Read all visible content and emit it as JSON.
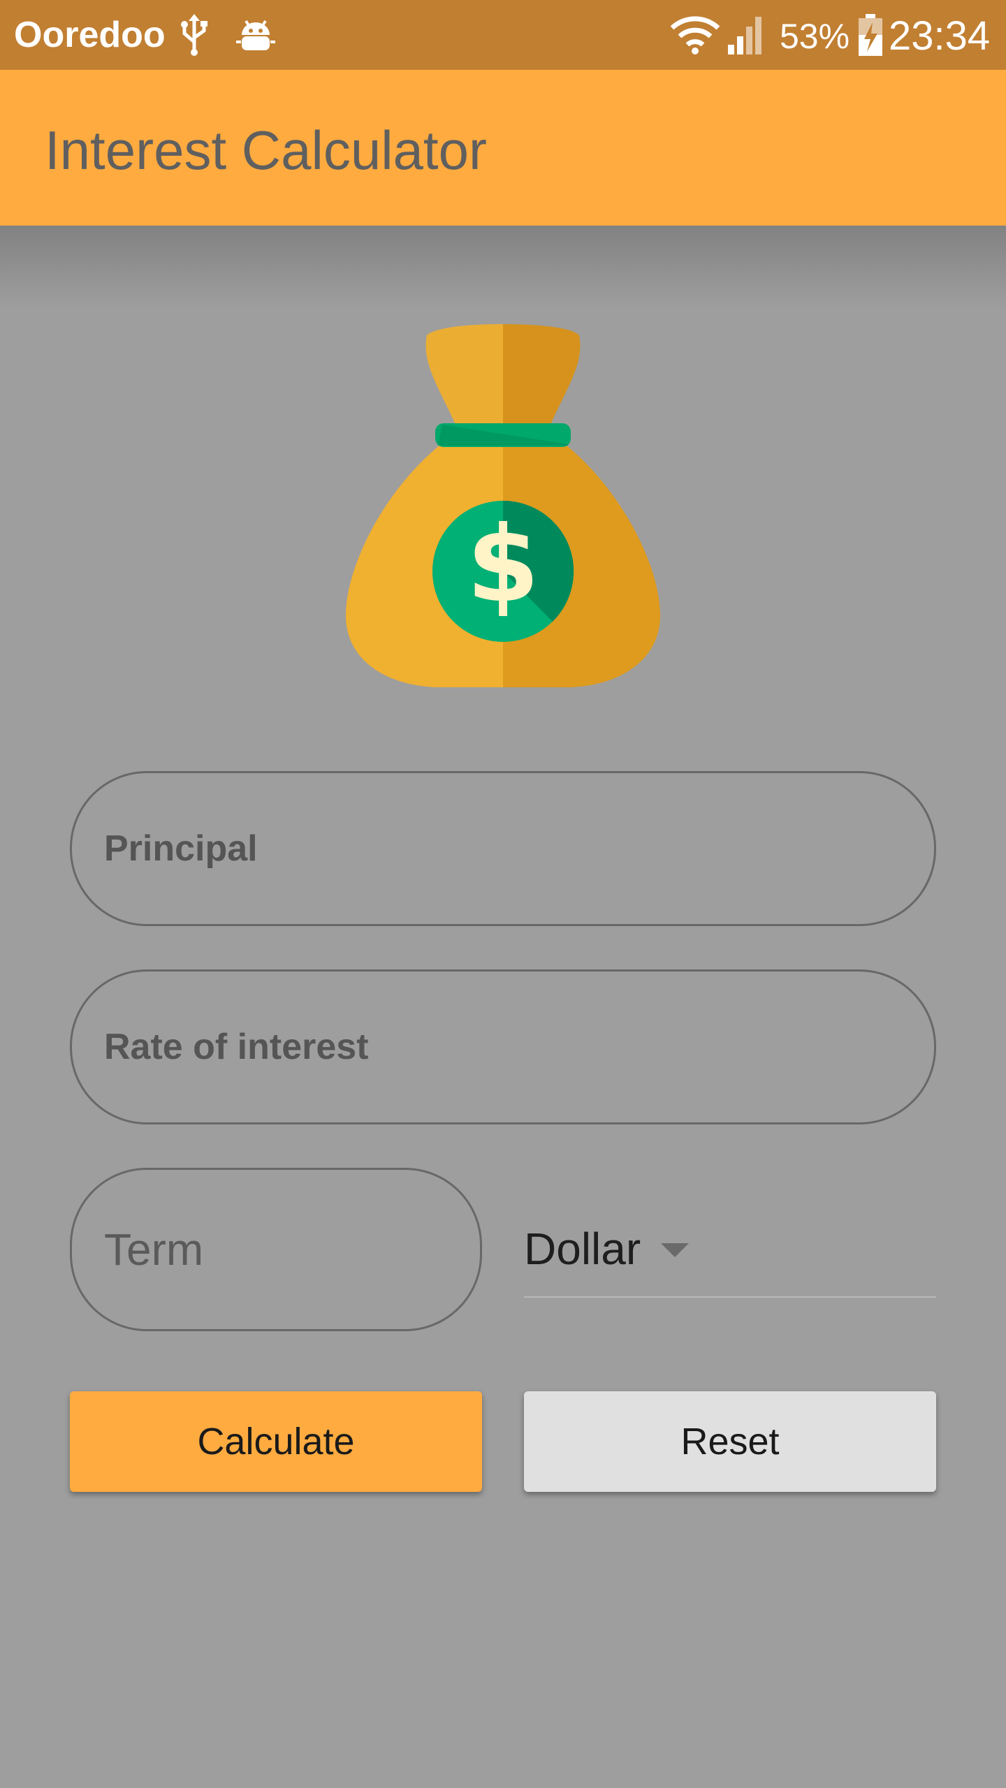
{
  "status_bar": {
    "carrier": "Ooredoo",
    "battery_percent": "53%",
    "time": "23:34",
    "icons": [
      "usb-icon",
      "android-debug-icon",
      "wifi-icon",
      "cell-signal-icon",
      "battery-charging-icon"
    ]
  },
  "app_bar": {
    "title": "Interest Calculator"
  },
  "illustration": {
    "icon": "money-bag-icon",
    "symbol": "$"
  },
  "form": {
    "principal_placeholder": "Principal",
    "rate_placeholder": "Rate of interest",
    "term_placeholder": "Term",
    "currency_selected": "Dollar"
  },
  "buttons": {
    "calculate_label": "Calculate",
    "reset_label": "Reset"
  },
  "colors": {
    "status_bar": "#c17f32",
    "app_bar": "#ffab40",
    "background": "#9e9e9e",
    "calculate_button": "#ffab40",
    "reset_button": "#e0e0e0",
    "bag_light": "#f0b030",
    "bag_dark": "#de9b1e",
    "coin_green": "#00b074"
  }
}
